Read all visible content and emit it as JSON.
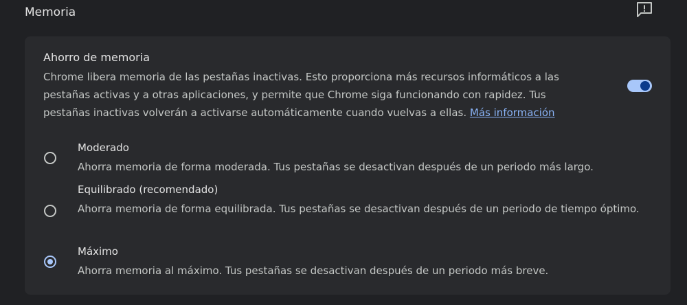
{
  "section": {
    "title": "Memoria",
    "feedback_icon": "feedback-icon"
  },
  "card": {
    "title": "Ahorro de memoria",
    "description": "Chrome libera memoria de las pestañas inactivas. Esto proporciona más recursos informáticos a las pestañas activas y a otras aplicaciones, y permite que Chrome siga funcionando con rapidez. Tus pestañas inactivas volverán a activarse automáticamente cuando vuelvas a ellas.",
    "link": "Más información",
    "toggle_on": true
  },
  "options": [
    {
      "label": "Moderado",
      "description": "Ahorra memoria de forma moderada. Tus pestañas se desactivan después de un periodo más largo.",
      "checked": false
    },
    {
      "label": "Equilibrado (recomendado)",
      "description": "Ahorra memoria de forma equilibrada. Tus pestañas se desactivan después de un periodo de tiempo óptimo.",
      "checked": false
    },
    {
      "label": "Máximo",
      "description": "Ahorra memoria al máximo. Tus pestañas se desactivan después de un periodo más breve.",
      "checked": true
    }
  ],
  "colors": {
    "background": "#202124",
    "card": "#292a2d",
    "accent": "#a8c7fa",
    "link": "#8ab4f8"
  }
}
